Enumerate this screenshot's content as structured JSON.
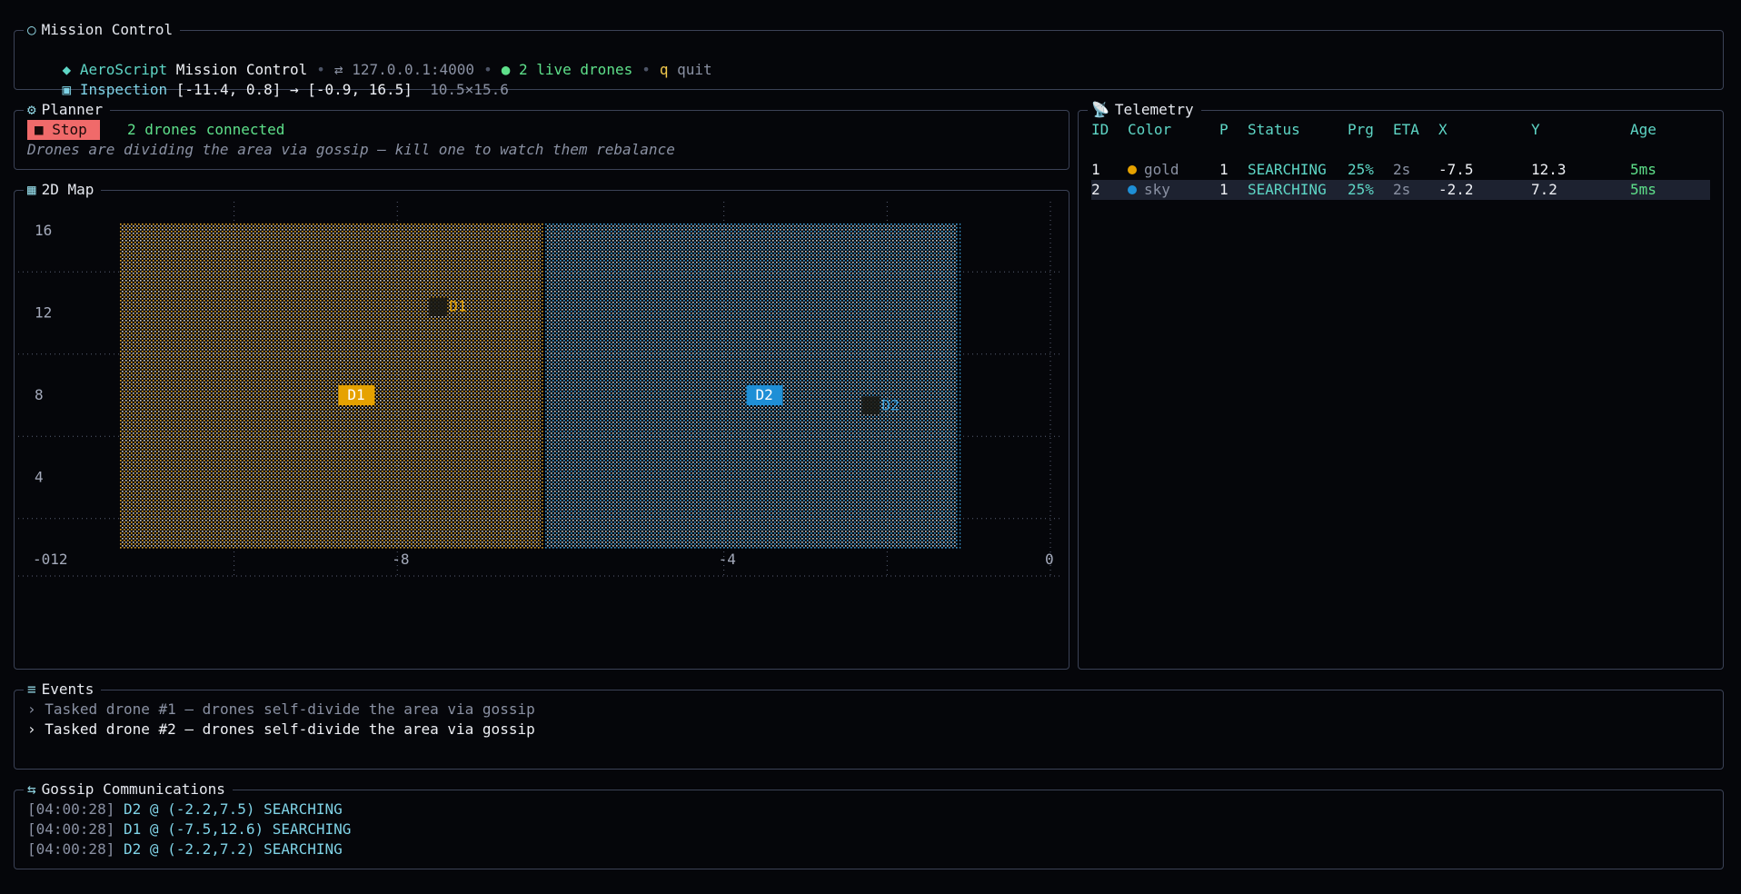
{
  "header": {
    "panel_title": "Mission Control",
    "panel_icon": "○",
    "brand_icon": "◆",
    "brand": "AeroScript",
    "brand_rest": "Mission Control",
    "sep": "•",
    "address_icon": "⇄",
    "address": "127.0.0.1:4000",
    "live_dot": "●",
    "live_drones": "2 live drones",
    "quit_key": "q",
    "quit_label": "quit",
    "inspection_icon": "▣",
    "inspection_label": "Inspection",
    "inspection_range": "[-11.4, 0.8] → [-0.9, 16.5]",
    "inspection_size": "10.5×15.6"
  },
  "planner": {
    "title": "Planner",
    "icon": "⚙",
    "stop_label": "■ Stop",
    "status": "2 drones connected",
    "hint": "Drones are dividing the area via gossip — kill one to watch them rebalance"
  },
  "map": {
    "title": "2D Map",
    "icon": "▦",
    "x_ticks": [
      "-012",
      "-8",
      "-4",
      "0"
    ],
    "y_ticks": [
      "16",
      "12",
      "8",
      "4"
    ],
    "markers": [
      {
        "label": "D1",
        "color": "#e6a200"
      },
      {
        "label": "D2",
        "color": "#1e8fd6"
      }
    ],
    "positions": [
      {
        "label": "D1",
        "x": -7.5,
        "y": 12.3,
        "color": "#e6a200"
      },
      {
        "label": "D2",
        "x": -2.2,
        "y": 7.5,
        "color": "#3aa0dc"
      }
    ],
    "regions": [
      {
        "label": "D1",
        "x0": -11.4,
        "x1": -6.2,
        "y0": 0.5,
        "y1": 16.4,
        "color": "#e0a020"
      },
      {
        "label": "D2",
        "x0": -6.2,
        "x1": -1.1,
        "y0": 0.5,
        "y1": 16.4,
        "color": "#3a9ad6"
      }
    ]
  },
  "telemetry": {
    "title": "Telemetry",
    "icon": "📡",
    "headers": [
      "ID",
      "Color",
      "P",
      "Status",
      "Prg",
      "ETA",
      "X",
      "Y",
      "Age"
    ],
    "rows": [
      {
        "id": "1",
        "color_name": "gold",
        "color": "#e6a200",
        "p": "1",
        "status": "SEARCHING",
        "prg": "25%",
        "eta": "2s",
        "x": "-7.5",
        "y": "12.3",
        "age": "5ms"
      },
      {
        "id": "2",
        "color_name": "sky",
        "color": "#1e8fd6",
        "p": "1",
        "status": "SEARCHING",
        "prg": "25%",
        "eta": "2s",
        "x": "-2.2",
        "y": "7.2",
        "age": "5ms"
      }
    ]
  },
  "events": {
    "title": "Events",
    "icon": "≡",
    "items": [
      {
        "marker": "›",
        "text": "Tasked drone #1 — drones self-divide the area via gossip"
      },
      {
        "marker": "›",
        "text": "Tasked drone #2 — drones self-divide the area via gossip"
      }
    ]
  },
  "gossip": {
    "title": "Gossip Communications",
    "icon": "⇆",
    "items": [
      {
        "time": "[04:00:28]",
        "text": "D2 @ (-2.2,7.5) SEARCHING"
      },
      {
        "time": "[04:00:28]",
        "text": "D1 @ (-7.5,12.6) SEARCHING"
      },
      {
        "time": "[04:00:28]",
        "text": "D2 @ (-2.2,7.2) SEARCHING"
      }
    ]
  },
  "colors": {
    "accent": "#5ed6c6",
    "gold": "#e6a200",
    "sky": "#1e8fd6",
    "stop": "#f06a6a",
    "border": "#3b4256"
  }
}
